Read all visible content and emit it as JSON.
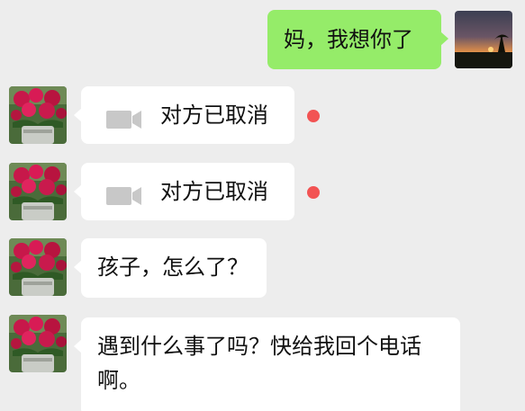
{
  "colors": {
    "background": "#ededed",
    "incoming_bubble": "#ffffff",
    "outgoing_bubble": "#95ec69",
    "unread_dot": "#f25353",
    "video_icon": "#c8c8c8"
  },
  "messages": [
    {
      "direction": "outgoing",
      "type": "text",
      "text": "妈，我想你了",
      "avatar": "sunset-avatar"
    },
    {
      "direction": "incoming",
      "type": "video-call",
      "text": "对方已取消",
      "icon": "video-camera-icon",
      "unread": true,
      "avatar": "flower-avatar"
    },
    {
      "direction": "incoming",
      "type": "video-call",
      "text": "对方已取消",
      "icon": "video-camera-icon",
      "unread": true,
      "avatar": "flower-avatar"
    },
    {
      "direction": "incoming",
      "type": "text",
      "text": "孩子，怎么了？",
      "avatar": "flower-avatar"
    },
    {
      "direction": "incoming",
      "type": "text",
      "text": "遇到什么事了吗？快给我回个电话\n啊。",
      "avatar": "flower-avatar"
    }
  ]
}
